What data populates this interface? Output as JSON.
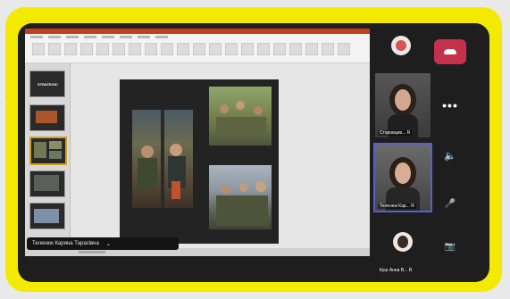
{
  "slides_panel": {
    "first_thumb_title": "STRATEGIC"
  },
  "participants": [
    {
      "name": "Старовцев...",
      "suffix": "R",
      "active": false
    },
    {
      "name": "Теленюк Кар...",
      "suffix": "R",
      "active": true
    },
    {
      "name": "Куш Анна В...",
      "suffix": "R",
      "active": false
    }
  ],
  "presenter": {
    "name": "Теленюк Карина Тарасівна",
    "chevron": "⌄"
  },
  "controls": {
    "more": "•••",
    "speaker": "🔈",
    "mic": "🎤",
    "camera": "📷"
  },
  "colors": {
    "frame": "#f4ea00",
    "hangup": "#c4314b",
    "active_tile": "#5b5fc7",
    "ppt_red": "#c43e1c"
  }
}
